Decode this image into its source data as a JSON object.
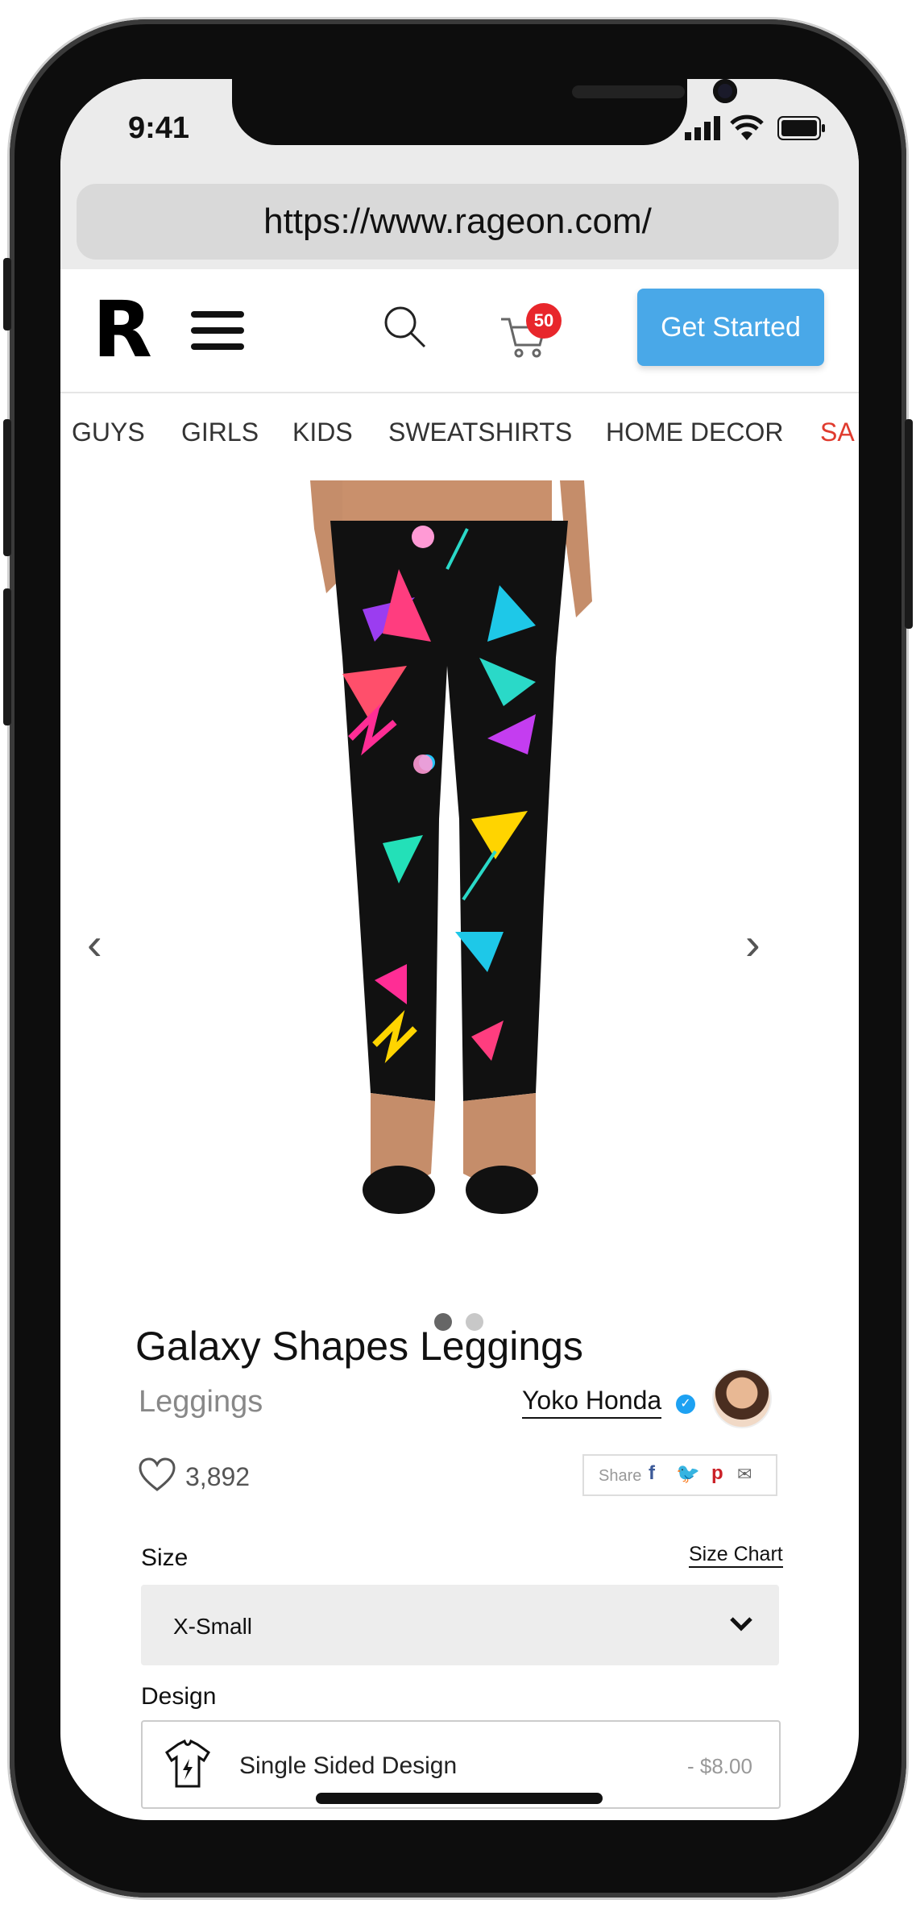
{
  "status": {
    "time": "9:41"
  },
  "browser": {
    "url": "https://www.rageon.com/"
  },
  "header": {
    "logo": "R",
    "cart_count": "50",
    "cta_label": "Get Started"
  },
  "nav": {
    "items": [
      "GUYS",
      "GIRLS",
      "KIDS",
      "SWEATSHIRTS",
      "HOME DECOR",
      "SA"
    ]
  },
  "product": {
    "title": "Galaxy Shapes Leggings",
    "category": "Leggings",
    "seller": "Yoko Honda",
    "likes": "3,892",
    "share_label": "Share",
    "size_label": "Size",
    "size_chart_label": "Size Chart",
    "size_value": "X-Small",
    "design_label": "Design",
    "design_option": {
      "name": "Single Sided Design",
      "price": "- $8.00"
    }
  },
  "colors": {
    "accent": "#49a8e8",
    "badge": "#e8262b",
    "sale": "#e03b2e"
  }
}
